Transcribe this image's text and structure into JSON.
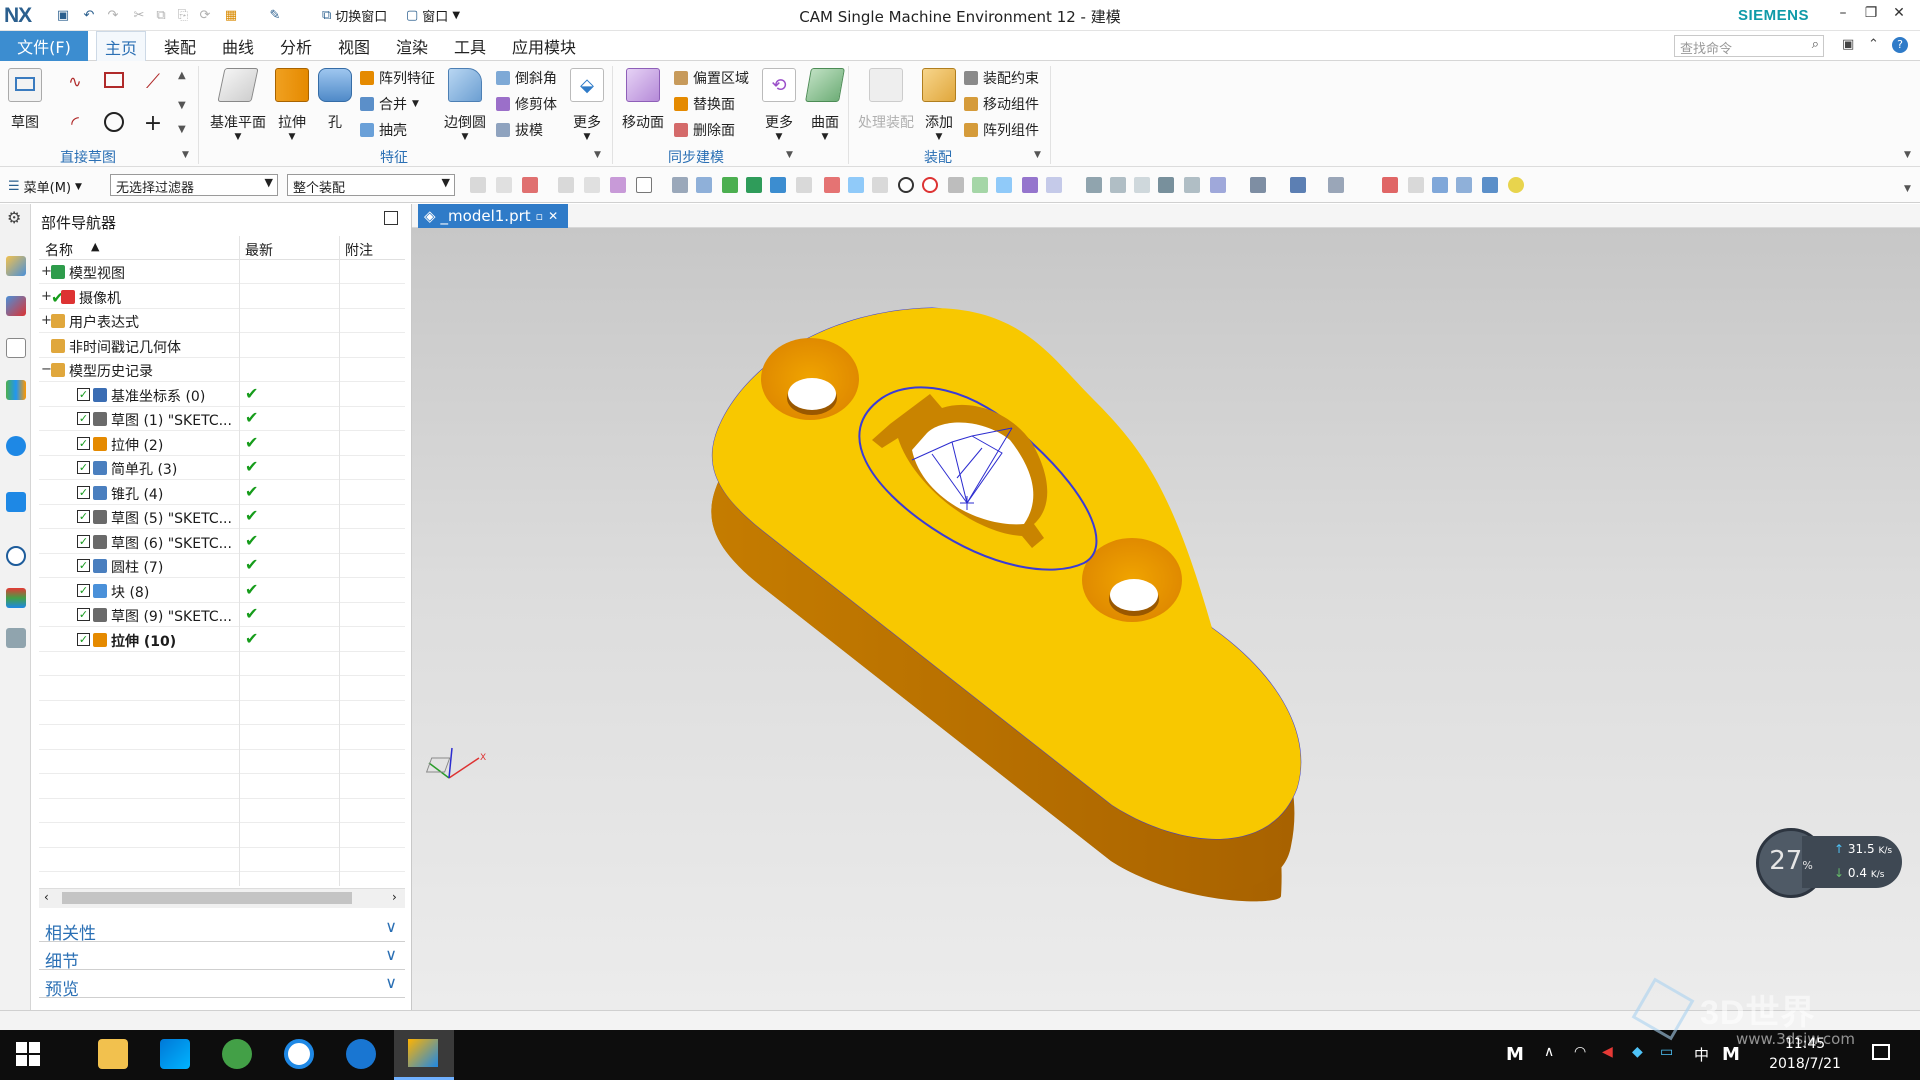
{
  "titlebar": {
    "logo": "NX",
    "switch_window": "切换窗口",
    "window_menu": "窗口",
    "app_title": "CAM Single Machine Environment 12 - 建模",
    "brand": "SIEMENS"
  },
  "menu": {
    "file": "文件(F)",
    "tabs": [
      "主页",
      "装配",
      "曲线",
      "分析",
      "视图",
      "渲染",
      "工具",
      "应用模块"
    ],
    "active_tab": "主页",
    "search_placeholder": "查找命令"
  },
  "ribbon": {
    "sketch": "草图",
    "group_direct_sketch": "直接草图",
    "datum_plane": "基准平面",
    "extrude": "拉伸",
    "hole": "孔",
    "pattern_feature": "阵列特征",
    "unite": "合并",
    "shell": "抽壳",
    "edge_blend": "边倒圆",
    "chamfer": "倒斜角",
    "trim_body": "修剪体",
    "draft": "拔模",
    "more": "更多",
    "group_feature": "特征",
    "move_face": "移动面",
    "offset_region": "偏置区域",
    "replace_face": "替换面",
    "delete_face": "删除面",
    "more2": "更多",
    "group_sync": "同步建模",
    "surface": "曲面",
    "process_assembly": "处理装配",
    "add": "添加",
    "assembly_constraint": "装配约束",
    "move_component": "移动组件",
    "pattern_component": "阵列组件",
    "group_assembly": "装配"
  },
  "toolbar2": {
    "menu": "菜单(M)",
    "filter": "无选择过滤器",
    "scope": "整个装配"
  },
  "navigator": {
    "title": "部件导航器",
    "columns": [
      "名称",
      "最新",
      "附注"
    ],
    "rows": [
      {
        "label": "模型视图",
        "level": 0,
        "expander": "+",
        "check": false,
        "latest": false
      },
      {
        "label": "摄像机",
        "level": 0,
        "expander": "+",
        "check": false,
        "latest": false
      },
      {
        "label": "用户表达式",
        "level": 0,
        "expander": "+",
        "check": false,
        "latest": false
      },
      {
        "label": "非时间戳记几何体",
        "level": 0,
        "expander": "",
        "check": false,
        "latest": false
      },
      {
        "label": "模型历史记录",
        "level": 0,
        "expander": "−",
        "check": false,
        "latest": false
      },
      {
        "label": "基准坐标系 (0)",
        "level": 1,
        "expander": "",
        "check": true,
        "latest": true
      },
      {
        "label": "草图 (1) \"SKETC...",
        "level": 1,
        "expander": "",
        "check": true,
        "latest": true
      },
      {
        "label": "拉伸 (2)",
        "level": 1,
        "expander": "",
        "check": true,
        "latest": true
      },
      {
        "label": "简单孔 (3)",
        "level": 1,
        "expander": "",
        "check": true,
        "latest": true
      },
      {
        "label": "锥孔 (4)",
        "level": 1,
        "expander": "",
        "check": true,
        "latest": true
      },
      {
        "label": "草图 (5) \"SKETC...",
        "level": 1,
        "expander": "",
        "check": true,
        "latest": true
      },
      {
        "label": "草图 (6) \"SKETC...",
        "level": 1,
        "expander": "",
        "check": true,
        "latest": true
      },
      {
        "label": "圆柱 (7)",
        "level": 1,
        "expander": "",
        "check": true,
        "latest": true
      },
      {
        "label": "块 (8)",
        "level": 1,
        "expander": "",
        "check": true,
        "latest": true
      },
      {
        "label": "草图 (9) \"SKETC...",
        "level": 1,
        "expander": "",
        "check": true,
        "latest": true
      },
      {
        "label": "拉伸 (10)",
        "level": 1,
        "expander": "",
        "check": true,
        "latest": true,
        "bold": true
      }
    ],
    "panels": [
      "相关性",
      "细节",
      "预览"
    ]
  },
  "graphics": {
    "file_tab": "_model1.prt"
  },
  "speed_widget": {
    "percent": "27",
    "percent_unit": "%",
    "up": "31.5",
    "down": "0.4",
    "unit": "K/s"
  },
  "taskbar": {
    "ime": "中",
    "time": "11:45",
    "date": "2018/7/21"
  },
  "watermark": {
    "main": "3D世界",
    "sub": "www.3dsjw.com"
  }
}
